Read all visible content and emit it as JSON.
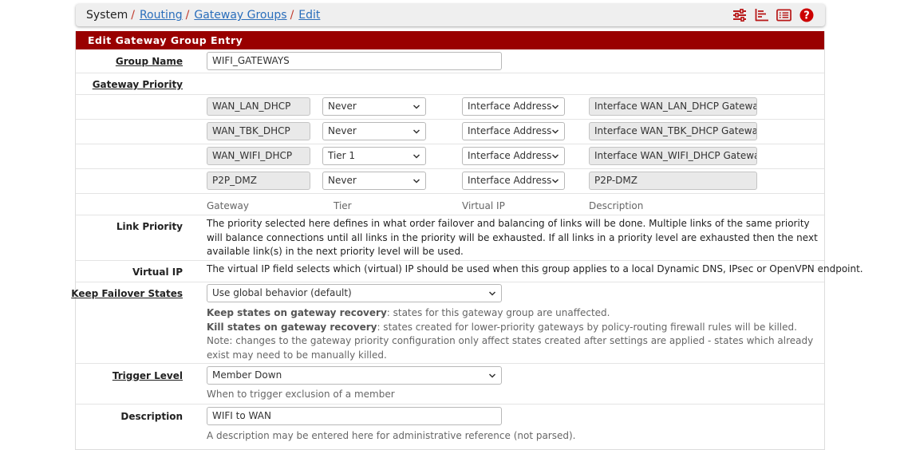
{
  "breadcrumb": {
    "root": "System",
    "items": [
      "Routing",
      "Gateway Groups",
      "Edit"
    ]
  },
  "toolbar": {
    "icons": [
      "sliders-icon",
      "chart-icon",
      "list-icon",
      "help-icon"
    ],
    "help_glyph": "?",
    "help_color": "#cc0000"
  },
  "panel": {
    "title": "Edit Gateway Group Entry",
    "header_color": "#990000"
  },
  "group_name": {
    "label": "Group Name",
    "value": "WIFI_GATEWAYS"
  },
  "gateway_priority": {
    "label": "Gateway Priority",
    "rows": [
      {
        "gateway": "WAN_LAN_DHCP",
        "tier": "Never",
        "vip": "Interface Address",
        "description": "Interface WAN_LAN_DHCP Gateway"
      },
      {
        "gateway": "WAN_TBK_DHCP",
        "tier": "Never",
        "vip": "Interface Address",
        "description": "Interface WAN_TBK_DHCP Gateway"
      },
      {
        "gateway": "WAN_WIFI_DHCP",
        "tier": "Tier 1",
        "vip": "Interface Address",
        "description": "Interface WAN_WIFI_DHCP Gateway"
      },
      {
        "gateway": "P2P_DMZ",
        "tier": "Never",
        "vip": "Interface Address",
        "description": "P2P-DMZ"
      }
    ],
    "columns": [
      "Gateway",
      "Tier",
      "Virtual IP",
      "Description"
    ]
  },
  "link_priority": {
    "label": "Link Priority",
    "text": "The priority selected here defines in what order failover and balancing of links will be done. Multiple links of the same priority will balance connections until all links in the priority will be exhausted. If all links in a priority level are exhausted then the next available link(s) in the next priority level will be used."
  },
  "virtual_ip": {
    "label": "Virtual IP",
    "text": "The virtual IP field selects which (virtual) IP should be used when this group applies to a local Dynamic DNS, IPsec or OpenVPN endpoint."
  },
  "keep_failover": {
    "label": "Keep Failover States",
    "value": "Use global behavior (default)",
    "help1_bold": "Keep states on gateway recovery",
    "help1_rest": ": states for this gateway group are unaffected.",
    "help2_bold": "Kill states on gateway recovery",
    "help2_rest": ": states created for lower-priority gateways by policy-routing firewall rules will be killed.",
    "note": "Note: changes to the gateway priority configuration only affect states created after settings are applied - states which already exist may need to be manually killed."
  },
  "trigger_level": {
    "label": "Trigger Level",
    "value": "Member Down",
    "help": "When to trigger exclusion of a member"
  },
  "description": {
    "label": "Description",
    "value": "WIFI to WAN",
    "help": "A description may be entered here for administrative reference (not parsed)."
  }
}
